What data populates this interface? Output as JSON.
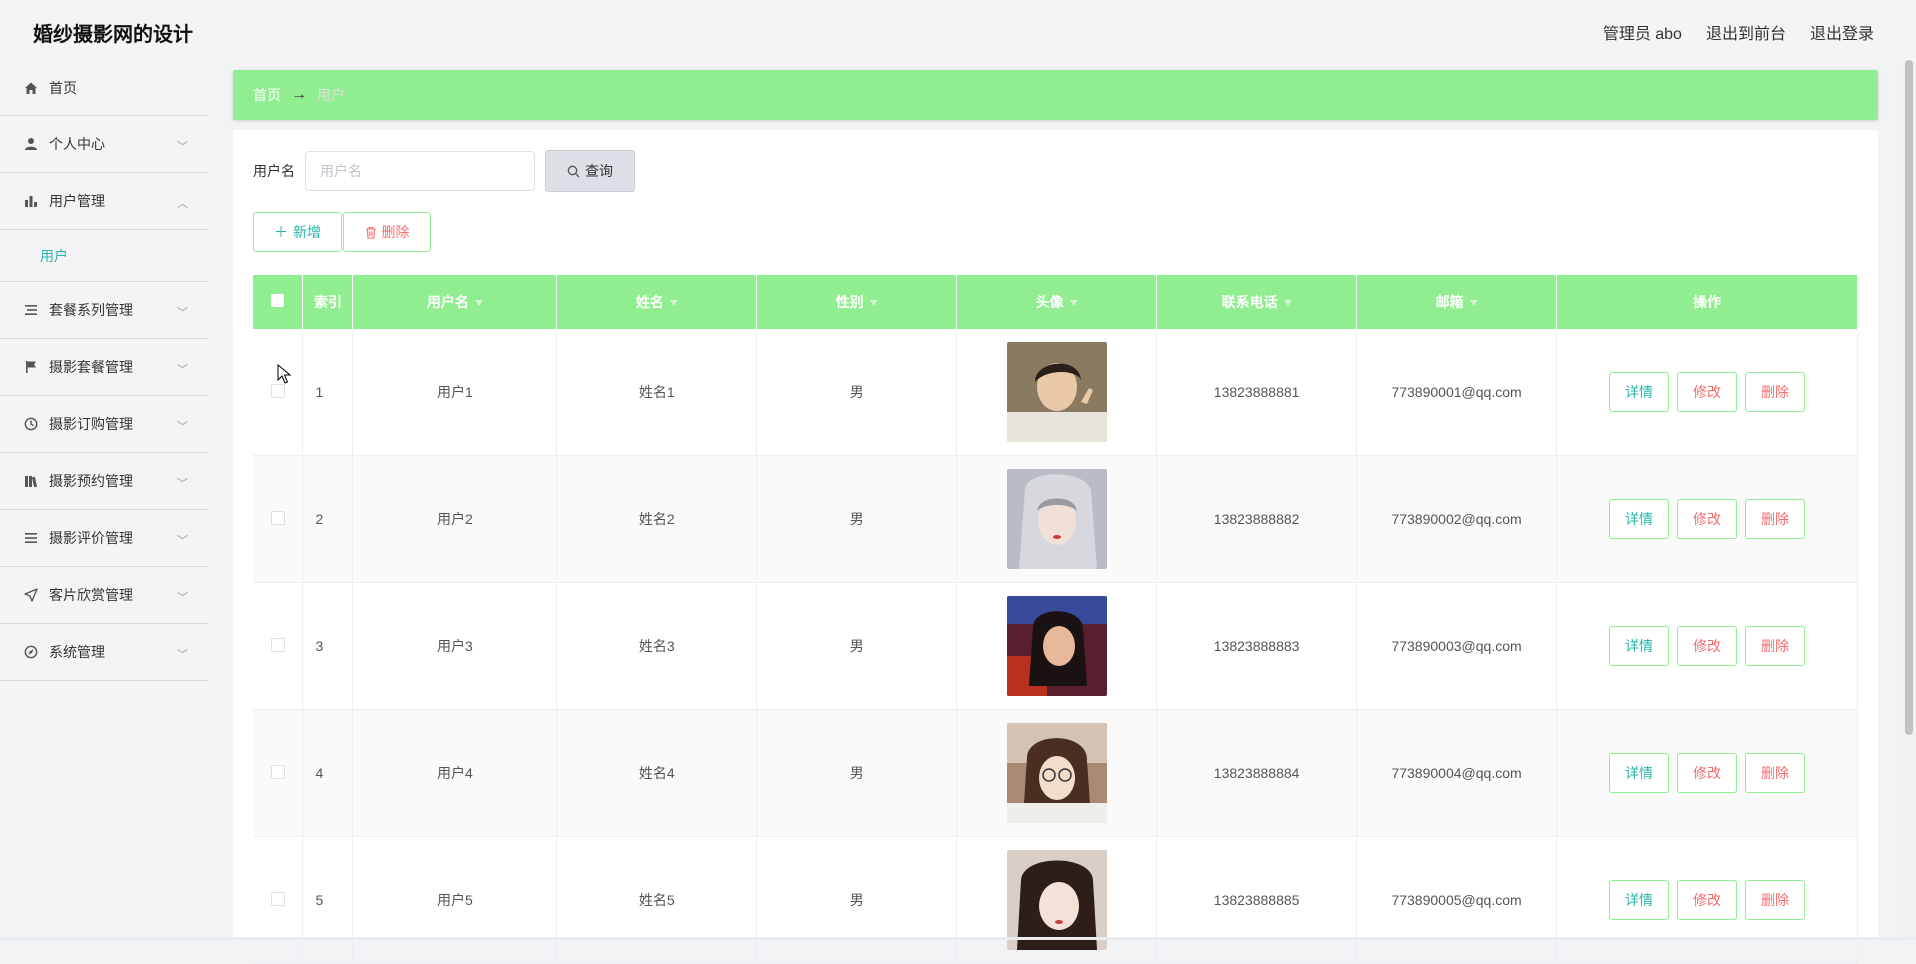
{
  "header": {
    "title": "婚纱摄影网的设计",
    "admin": "管理员 abo",
    "back_front": "退出到前台",
    "logout": "退出登录"
  },
  "sidebar": {
    "items": [
      {
        "label": "首页",
        "icon": "home-icon"
      },
      {
        "label": "个人中心",
        "icon": "user-icon"
      },
      {
        "label": "用户管理",
        "icon": "bar-chart-icon"
      },
      {
        "label": "套餐系列管理",
        "icon": "list-icon"
      },
      {
        "label": "摄影套餐管理",
        "icon": "flag-icon"
      },
      {
        "label": "摄影订购管理",
        "icon": "clock-icon"
      },
      {
        "label": "摄影预约管理",
        "icon": "book-icon"
      },
      {
        "label": "摄影评价管理",
        "icon": "menu-icon"
      },
      {
        "label": "客片欣赏管理",
        "icon": "send-icon"
      },
      {
        "label": "系统管理",
        "icon": "compass-icon"
      }
    ],
    "sub_user": "用户"
  },
  "breadcrumb": {
    "home": "首页",
    "arrow": "→",
    "current": "用户"
  },
  "search": {
    "label": "用户名",
    "placeholder": "用户名",
    "button": "查询"
  },
  "actions": {
    "add": "新增",
    "delete": "删除"
  },
  "table": {
    "headers": [
      "索引",
      "用户名",
      "姓名",
      "性别",
      "头像",
      "联系电话",
      "邮箱",
      "操作"
    ],
    "rows": [
      {
        "index": "1",
        "username": "用户1",
        "name": "姓名1",
        "gender": "男",
        "phone": "13823888881",
        "email": "773890001@qq.com"
      },
      {
        "index": "2",
        "username": "用户2",
        "name": "姓名2",
        "gender": "男",
        "phone": "13823888882",
        "email": "773890002@qq.com"
      },
      {
        "index": "3",
        "username": "用户3",
        "name": "姓名3",
        "gender": "男",
        "phone": "13823888883",
        "email": "773890003@qq.com"
      },
      {
        "index": "4",
        "username": "用户4",
        "name": "姓名4",
        "gender": "男",
        "phone": "13823888884",
        "email": "773890004@qq.com"
      },
      {
        "index": "5",
        "username": "用户5",
        "name": "姓名5",
        "gender": "男",
        "phone": "13823888885",
        "email": "773890005@qq.com"
      }
    ],
    "row_buttons": {
      "detail": "详情",
      "edit": "修改",
      "delete": "删除"
    }
  },
  "colors": {
    "accent": "#90ee90",
    "teal": "#26b7a8",
    "danger": "#f56c6c"
  }
}
